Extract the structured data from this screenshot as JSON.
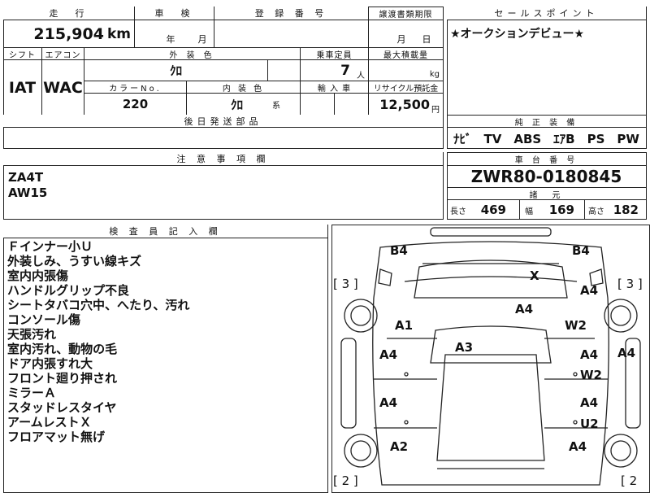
{
  "header": {
    "mileage_label": "走　行",
    "shaken_label": "車　検",
    "registration_label": "登 録 番 号",
    "transfer_deadline_label": "譲渡書類期限",
    "sales_point_label": "セールスポイント"
  },
  "mileage": {
    "value": "215,904",
    "unit": "km"
  },
  "shaken": {
    "year_unit": "年",
    "month_unit": "月"
  },
  "transfer": {
    "month_unit": "月",
    "day_unit": "日"
  },
  "sales_point": {
    "text": "★オークションデビュー★"
  },
  "spec_labels": {
    "shift": "シフト",
    "aircon": "エアコン",
    "exterior_color": "外 装 色",
    "capacity": "乗車定員",
    "max_load": "最大積載量",
    "color_no": "カラーNo.",
    "interior_color": "内 装 色",
    "import": "輸 入 車",
    "recycle": "リサイクル預託金",
    "later_parts": "後日発送部品"
  },
  "spec": {
    "shift": "IAT",
    "aircon": "WAC",
    "exterior_color": "ｸﾛ",
    "capacity": "7",
    "capacity_unit": "人",
    "max_load_unit": "kg",
    "color_no": "220",
    "interior_color": "ｸﾛ",
    "interior_suffix": "系",
    "recycle_fee": "12,500",
    "recycle_unit": "円"
  },
  "equipment": {
    "label": "純 正 装 備",
    "items": "ﾅﾋﾞ　TV　ABS　ｴｱB　PS　PW"
  },
  "notes": {
    "label": "注 意 事 項 欄",
    "lines": [
      "ZA4T",
      "AW15"
    ]
  },
  "chassis": {
    "label": "車 台 番 号",
    "number": "ZWR80-0180845"
  },
  "dimensions": {
    "label": "諸　元",
    "length_label": "長さ",
    "length": "469",
    "width_label": "幅",
    "width": "169",
    "height_label": "高さ",
    "height": "182"
  },
  "inspector": {
    "label": "検 査 員 記 入 欄",
    "lines": [
      "Ｆインナー小Ｕ",
      "外装しみ、うすい線キズ",
      "室内内張傷",
      "ハンドルグリップ不良",
      "シートタバコ穴中、へたり、汚れ",
      "コンソール傷",
      "天張汚れ",
      "室内汚れ、動物の毛",
      "ドア内張すれ大",
      "フロント廻り押され",
      "ミラーＡ",
      "スタッドレスタイヤ",
      "アームレストＸ",
      "フロアマット無げ"
    ]
  },
  "diagram": {
    "b4_left": "B4",
    "b4_right": "B4",
    "x_mark": "X",
    "bracket_left_top": "[ 3 ]",
    "bracket_right_top": "[ 3 ]",
    "a4_hood": "A4",
    "a4_right_front": "A4",
    "a1": "A1",
    "w2_right": "W2",
    "a3": "A3",
    "a4_side_right": "A4",
    "a4_left_door1": "A4",
    "a4_right_door1": "A4",
    "w2_door": "W2",
    "a4_left_door2": "A4",
    "a4_right_door2": "A4",
    "u2": "U2",
    "a2": "A2",
    "a4_rear_right": "A4",
    "bracket_left_bottom": "[ 2 ]",
    "bracket_right_bottom": "[ 2"
  }
}
